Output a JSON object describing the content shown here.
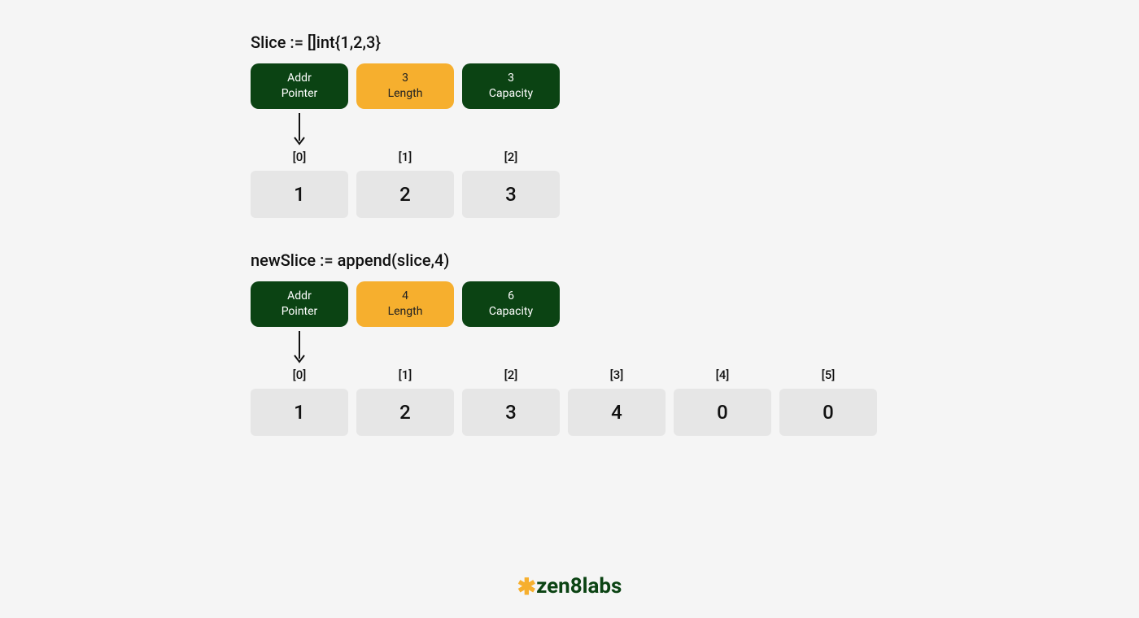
{
  "brand": {
    "name": "zen8labs",
    "asterisk": "✱"
  },
  "colors": {
    "green": "#0b4313",
    "orange": "#f6af2e",
    "cell": "#e6e6e6"
  },
  "section1": {
    "title": "Slice := []int{1,2,3}",
    "header": {
      "addr": {
        "line1": "Addr",
        "line2": "Pointer"
      },
      "length": {
        "value": "3",
        "label": "Length"
      },
      "capacity": {
        "value": "3",
        "label": "Capacity"
      }
    },
    "cells": [
      {
        "index": "[0]",
        "value": "1"
      },
      {
        "index": "[1]",
        "value": "2"
      },
      {
        "index": "[2]",
        "value": "3"
      }
    ]
  },
  "section2": {
    "title": "newSlice := append(slice,4)",
    "header": {
      "addr": {
        "line1": "Addr",
        "line2": "Pointer"
      },
      "length": {
        "value": "4",
        "label": "Length"
      },
      "capacity": {
        "value": "6",
        "label": "Capacity"
      }
    },
    "cells": [
      {
        "index": "[0]",
        "value": "1"
      },
      {
        "index": "[1]",
        "value": "2"
      },
      {
        "index": "[2]",
        "value": "3"
      },
      {
        "index": "[3]",
        "value": "4"
      },
      {
        "index": "[4]",
        "value": "0"
      },
      {
        "index": "[5]",
        "value": "0"
      }
    ]
  }
}
